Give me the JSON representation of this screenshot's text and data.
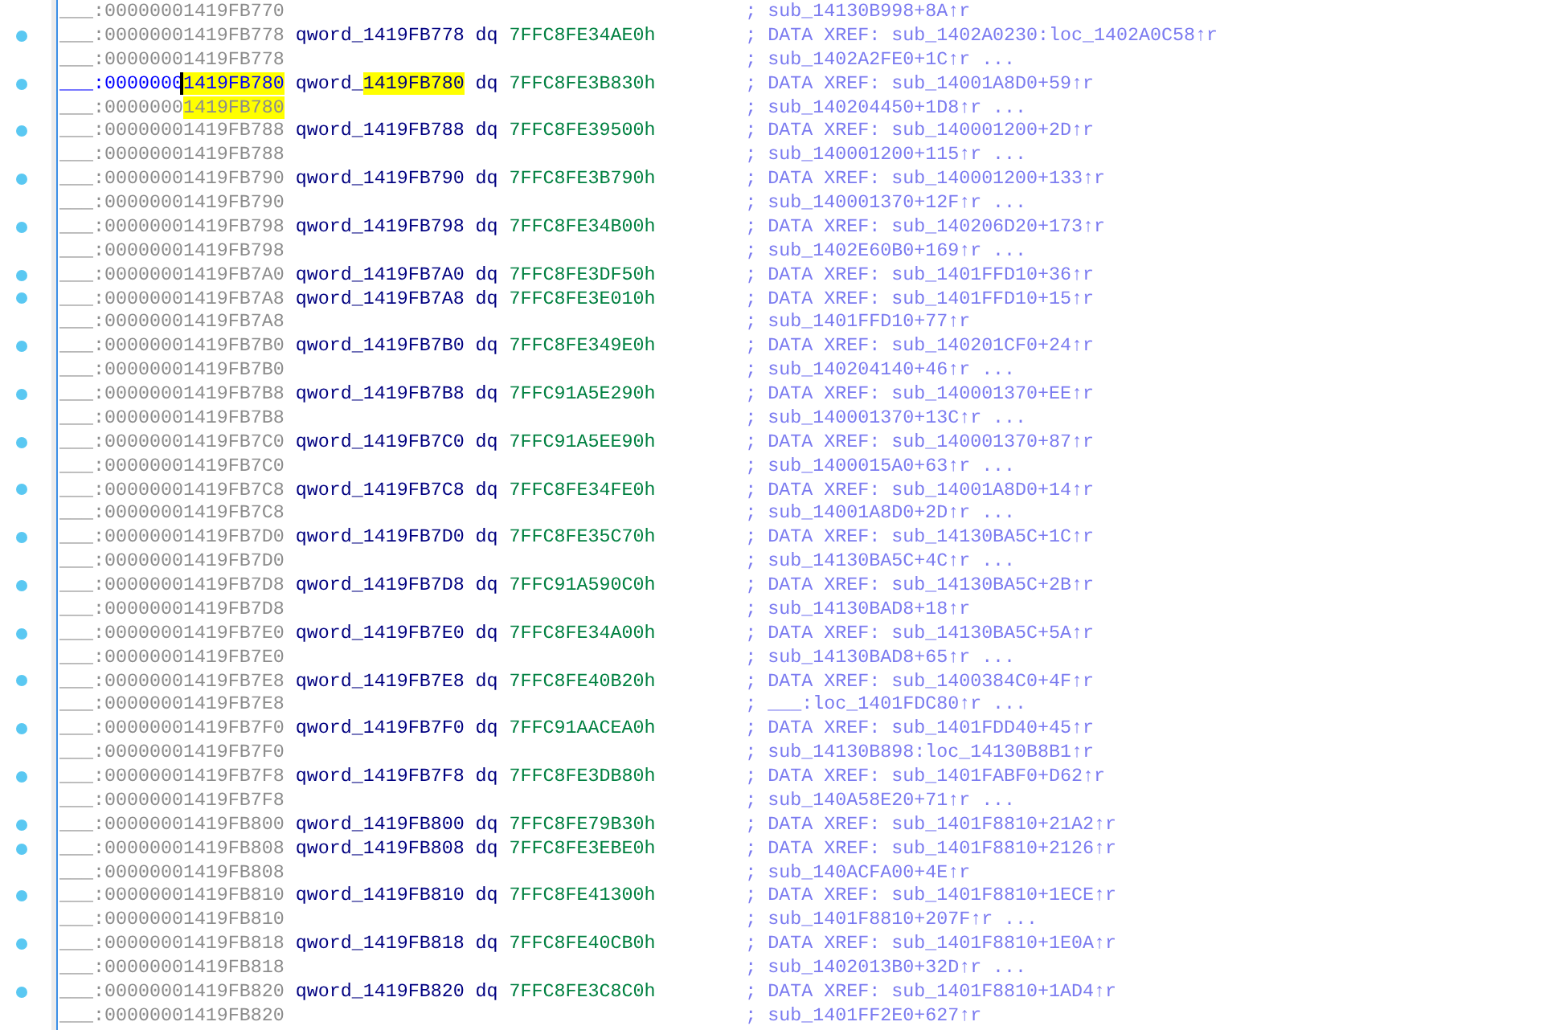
{
  "lines": [
    {
      "kind": "comment",
      "selected": false,
      "address": "___:00000001419FB770",
      "comment": "; sub_14130B998+8A↑r"
    },
    {
      "kind": "data",
      "selected": false,
      "address": "___:00000001419FB778",
      "name": "qword_1419FB778",
      "directive": "dq",
      "value": "7FFC8FE34AE0h",
      "comment": "; DATA XREF: sub_1402A0230:loc_1402A0C58↑r"
    },
    {
      "kind": "comment",
      "selected": false,
      "address": "___:00000001419FB778",
      "comment": "; sub_1402A2FE0+1C↑r ..."
    },
    {
      "kind": "data",
      "selected": true,
      "address": "___:0000000",
      "address_match": "1419FB780",
      "name": "qword_",
      "name_match": "1419FB780",
      "directive": "dq",
      "value": "7FFC8FE3B830h",
      "comment": "; DATA XREF: sub_14001A8D0+59↑r"
    },
    {
      "kind": "comment",
      "selected": false,
      "address": "___:0000000",
      "address_match": "1419FB780",
      "comment": "; sub_140204450+1D8↑r ..."
    },
    {
      "kind": "data",
      "selected": false,
      "address": "___:00000001419FB788",
      "name": "qword_1419FB788",
      "directive": "dq",
      "value": "7FFC8FE39500h",
      "comment": "; DATA XREF: sub_140001200+2D↑r"
    },
    {
      "kind": "comment",
      "selected": false,
      "address": "___:00000001419FB788",
      "comment": "; sub_140001200+115↑r ..."
    },
    {
      "kind": "data",
      "selected": false,
      "address": "___:00000001419FB790",
      "name": "qword_1419FB790",
      "directive": "dq",
      "value": "7FFC8FE3B790h",
      "comment": "; DATA XREF: sub_140001200+133↑r"
    },
    {
      "kind": "comment",
      "selected": false,
      "address": "___:00000001419FB790",
      "comment": "; sub_140001370+12F↑r ..."
    },
    {
      "kind": "data",
      "selected": false,
      "address": "___:00000001419FB798",
      "name": "qword_1419FB798",
      "directive": "dq",
      "value": "7FFC8FE34B00h",
      "comment": "; DATA XREF: sub_140206D20+173↑r"
    },
    {
      "kind": "comment",
      "selected": false,
      "address": "___:00000001419FB798",
      "comment": "; sub_1402E60B0+169↑r ..."
    },
    {
      "kind": "data",
      "selected": false,
      "address": "___:00000001419FB7A0",
      "name": "qword_1419FB7A0",
      "directive": "dq",
      "value": "7FFC8FE3DF50h",
      "comment": "; DATA XREF: sub_1401FFD10+36↑r"
    },
    {
      "kind": "data",
      "selected": false,
      "address": "___:00000001419FB7A8",
      "name": "qword_1419FB7A8",
      "directive": "dq",
      "value": "7FFC8FE3E010h",
      "comment": "; DATA XREF: sub_1401FFD10+15↑r"
    },
    {
      "kind": "comment",
      "selected": false,
      "address": "___:00000001419FB7A8",
      "comment": "; sub_1401FFD10+77↑r"
    },
    {
      "kind": "data",
      "selected": false,
      "address": "___:00000001419FB7B0",
      "name": "qword_1419FB7B0",
      "directive": "dq",
      "value": "7FFC8FE349E0h",
      "comment": "; DATA XREF: sub_140201CF0+24↑r"
    },
    {
      "kind": "comment",
      "selected": false,
      "address": "___:00000001419FB7B0",
      "comment": "; sub_140204140+46↑r ..."
    },
    {
      "kind": "data",
      "selected": false,
      "address": "___:00000001419FB7B8",
      "name": "qword_1419FB7B8",
      "directive": "dq",
      "value": "7FFC91A5E290h",
      "comment": "; DATA XREF: sub_140001370+EE↑r"
    },
    {
      "kind": "comment",
      "selected": false,
      "address": "___:00000001419FB7B8",
      "comment": "; sub_140001370+13C↑r ..."
    },
    {
      "kind": "data",
      "selected": false,
      "address": "___:00000001419FB7C0",
      "name": "qword_1419FB7C0",
      "directive": "dq",
      "value": "7FFC91A5EE90h",
      "comment": "; DATA XREF: sub_140001370+87↑r"
    },
    {
      "kind": "comment",
      "selected": false,
      "address": "___:00000001419FB7C0",
      "comment": "; sub_1400015A0+63↑r ..."
    },
    {
      "kind": "data",
      "selected": false,
      "address": "___:00000001419FB7C8",
      "name": "qword_1419FB7C8",
      "directive": "dq",
      "value": "7FFC8FE34FE0h",
      "comment": "; DATA XREF: sub_14001A8D0+14↑r"
    },
    {
      "kind": "comment",
      "selected": false,
      "address": "___:00000001419FB7C8",
      "comment": "; sub_14001A8D0+2D↑r ..."
    },
    {
      "kind": "data",
      "selected": false,
      "address": "___:00000001419FB7D0",
      "name": "qword_1419FB7D0",
      "directive": "dq",
      "value": "7FFC8FE35C70h",
      "comment": "; DATA XREF: sub_14130BA5C+1C↑r"
    },
    {
      "kind": "comment",
      "selected": false,
      "address": "___:00000001419FB7D0",
      "comment": "; sub_14130BA5C+4C↑r ..."
    },
    {
      "kind": "data",
      "selected": false,
      "address": "___:00000001419FB7D8",
      "name": "qword_1419FB7D8",
      "directive": "dq",
      "value": "7FFC91A590C0h",
      "comment": "; DATA XREF: sub_14130BA5C+2B↑r"
    },
    {
      "kind": "comment",
      "selected": false,
      "address": "___:00000001419FB7D8",
      "comment": "; sub_14130BAD8+18↑r"
    },
    {
      "kind": "data",
      "selected": false,
      "address": "___:00000001419FB7E0",
      "name": "qword_1419FB7E0",
      "directive": "dq",
      "value": "7FFC8FE34A00h",
      "comment": "; DATA XREF: sub_14130BA5C+5A↑r"
    },
    {
      "kind": "comment",
      "selected": false,
      "address": "___:00000001419FB7E0",
      "comment": "; sub_14130BAD8+65↑r ..."
    },
    {
      "kind": "data",
      "selected": false,
      "address": "___:00000001419FB7E8",
      "name": "qword_1419FB7E8",
      "directive": "dq",
      "value": "7FFC8FE40B20h",
      "comment": "; DATA XREF: sub_1400384C0+4F↑r"
    },
    {
      "kind": "comment",
      "selected": false,
      "address": "___:00000001419FB7E8",
      "comment": "; ___:loc_1401FDC80↑r ..."
    },
    {
      "kind": "data",
      "selected": false,
      "address": "___:00000001419FB7F0",
      "name": "qword_1419FB7F0",
      "directive": "dq",
      "value": "7FFC91AACEA0h",
      "comment": "; DATA XREF: sub_1401FDD40+45↑r"
    },
    {
      "kind": "comment",
      "selected": false,
      "address": "___:00000001419FB7F0",
      "comment": "; sub_14130B898:loc_14130B8B1↑r"
    },
    {
      "kind": "data",
      "selected": false,
      "address": "___:00000001419FB7F8",
      "name": "qword_1419FB7F8",
      "directive": "dq",
      "value": "7FFC8FE3DB80h",
      "comment": "; DATA XREF: sub_1401FABF0+D62↑r"
    },
    {
      "kind": "comment",
      "selected": false,
      "address": "___:00000001419FB7F8",
      "comment": "; sub_140A58E20+71↑r ..."
    },
    {
      "kind": "data",
      "selected": false,
      "address": "___:00000001419FB800",
      "name": "qword_1419FB800",
      "directive": "dq",
      "value": "7FFC8FE79B30h",
      "comment": "; DATA XREF: sub_1401F8810+21A2↑r"
    },
    {
      "kind": "data",
      "selected": false,
      "address": "___:00000001419FB808",
      "name": "qword_1419FB808",
      "directive": "dq",
      "value": "7FFC8FE3EBE0h",
      "comment": "; DATA XREF: sub_1401F8810+2126↑r"
    },
    {
      "kind": "comment",
      "selected": false,
      "address": "___:00000001419FB808",
      "comment": "; sub_140ACFA00+4E↑r"
    },
    {
      "kind": "data",
      "selected": false,
      "address": "___:00000001419FB810",
      "name": "qword_1419FB810",
      "directive": "dq",
      "value": "7FFC8FE41300h",
      "comment": "; DATA XREF: sub_1401F8810+1ECE↑r"
    },
    {
      "kind": "comment",
      "selected": false,
      "address": "___:00000001419FB810",
      "comment": "; sub_1401F8810+207F↑r ..."
    },
    {
      "kind": "data",
      "selected": false,
      "address": "___:00000001419FB818",
      "name": "qword_1419FB818",
      "directive": "dq",
      "value": "7FFC8FE40CB0h",
      "comment": "; DATA XREF: sub_1401F8810+1E0A↑r"
    },
    {
      "kind": "comment",
      "selected": false,
      "address": "___:00000001419FB818",
      "comment": "; sub_1402013B0+32D↑r ..."
    },
    {
      "kind": "data",
      "selected": false,
      "address": "___:00000001419FB820",
      "name": "qword_1419FB820",
      "directive": "dq",
      "value": "7FFC8FE3C8C0h",
      "comment": "; DATA XREF: sub_1401F8810+1AD4↑r"
    },
    {
      "kind": "comment",
      "selected": false,
      "address": "___:00000001419FB820",
      "comment": "; sub_1401FF2E0+627↑r"
    }
  ]
}
